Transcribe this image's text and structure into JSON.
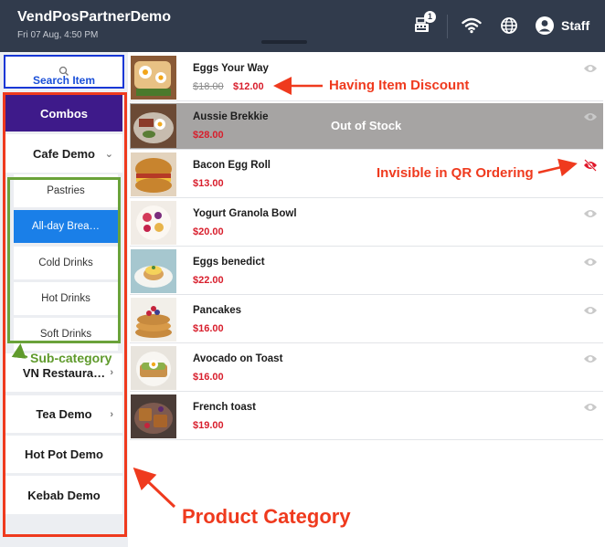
{
  "header": {
    "title": "VendPosPartnerDemo",
    "datetime": "Fri 07 Aug, 4:50 PM",
    "register_badge": "1",
    "staff_label": "Staff",
    "icons": [
      "cash-register-icon",
      "wifi-icon",
      "globe-icon",
      "user-icon"
    ]
  },
  "sidebar": {
    "search_label": "Search Item",
    "categories": [
      {
        "label": "Combos",
        "active": true
      },
      {
        "label": "Cafe Demo",
        "expanded": true
      },
      {
        "label": "VN Restaura…"
      },
      {
        "label": "Tea Demo"
      },
      {
        "label": "Hot Pot Demo"
      },
      {
        "label": "Kebab Demo"
      }
    ],
    "subcategories": [
      {
        "label": "Pastries"
      },
      {
        "label": "All-day Brea…",
        "active": true
      },
      {
        "label": "Cold Drinks"
      },
      {
        "label": "Hot Drinks"
      },
      {
        "label": "Soft Drinks"
      }
    ]
  },
  "products": [
    {
      "name": "Eggs Your Way",
      "original_price": "$18.00",
      "price": "$12.00",
      "visible": true
    },
    {
      "name": "Aussie Brekkie",
      "price": "$28.00",
      "status": "Out of Stock",
      "visible": true
    },
    {
      "name": "Bacon Egg Roll",
      "price": "$13.00",
      "visible": false
    },
    {
      "name": "Yogurt Granola Bowl",
      "price": "$20.00",
      "visible": true
    },
    {
      "name": "Eggs benedict",
      "price": "$22.00",
      "visible": true
    },
    {
      "name": "Pancakes",
      "price": "$16.00",
      "visible": true
    },
    {
      "name": "Avocado on Toast",
      "price": "$16.00",
      "visible": true
    },
    {
      "name": "French toast",
      "price": "$19.00",
      "visible": true
    }
  ],
  "annotations": {
    "discount": "Having Item Discount",
    "invisible": "Invisible in QR Ordering",
    "subcategory": "Sub-category",
    "category": "Product Category"
  },
  "colors": {
    "header_bg": "#313b4c",
    "category_active": "#3e1a8a",
    "subcategory_active": "#1a7fe8",
    "price_red": "#d81e2c",
    "annotation_red": "#ef3a1e",
    "annotation_green": "#6aa23a",
    "annotation_blue": "#1737d6"
  }
}
